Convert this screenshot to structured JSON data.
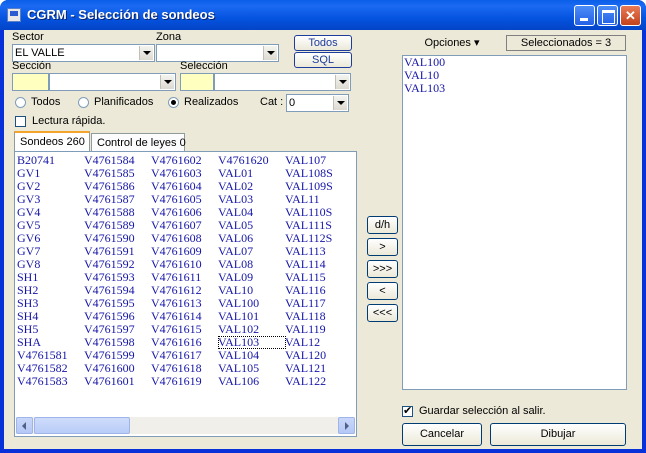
{
  "window": {
    "title": "CGRM - Selección de sondeos"
  },
  "filters": {
    "sector_label": "Sector",
    "sector_value": "EL VALLE",
    "zona_label": "Zona",
    "zona_value": "",
    "seccion_label": "Sección",
    "seccion_value": "",
    "seleccion_label": "Selección",
    "seleccion_value": "",
    "todos_button": "Todos",
    "sql_button": "SQL"
  },
  "radios": [
    {
      "label": "Todos",
      "checked": false
    },
    {
      "label": "Planificados",
      "checked": false
    },
    {
      "label": "Realizados",
      "checked": true
    }
  ],
  "cat": {
    "label": "Cat :",
    "value": "0"
  },
  "lectura_rapida": {
    "label": "Lectura rápida.",
    "checked": false
  },
  "tabs": [
    {
      "label": "Sondeos",
      "count": "260"
    },
    {
      "label": "Control de leyes",
      "count": "0"
    }
  ],
  "grid": {
    "selected": "VAL103",
    "columns": [
      [
        "B20741",
        "GV1",
        "GV2",
        "GV3",
        "GV4",
        "GV5",
        "GV6",
        "GV7",
        "GV8",
        "SH1",
        "SH2",
        "SH3",
        "SH4",
        "SH5",
        "SHA",
        "V4761581",
        "V4761582",
        "V4761583"
      ],
      [
        "V4761584",
        "V4761585",
        "V4761586",
        "V4761587",
        "V4761588",
        "V4761589",
        "V4761590",
        "V4761591",
        "V4761592",
        "V4761593",
        "V4761594",
        "V4761595",
        "V4761596",
        "V4761597",
        "V4761598",
        "V4761599",
        "V4761600",
        "V4761601"
      ],
      [
        "V4761602",
        "V4761603",
        "V4761604",
        "V4761605",
        "V4761606",
        "V4761607",
        "V4761608",
        "V4761609",
        "V4761610",
        "V4761611",
        "V4761612",
        "V4761613",
        "V4761614",
        "V4761615",
        "V4761616",
        "V4761617",
        "V4761618",
        "V4761619"
      ],
      [
        "V4761620",
        "VAL01",
        "VAL02",
        "VAL03",
        "VAL04",
        "VAL05",
        "VAL06",
        "VAL07",
        "VAL08",
        "VAL09",
        "VAL10",
        "VAL100",
        "VAL101",
        "VAL102",
        "VAL103",
        "VAL104",
        "VAL105",
        "VAL106"
      ],
      [
        "VAL107",
        "VAL108S",
        "VAL109S",
        "VAL11",
        "VAL110S",
        "VAL111S",
        "VAL112S",
        "VAL113",
        "VAL114",
        "VAL115",
        "VAL116",
        "VAL117",
        "VAL118",
        "VAL119",
        "VAL12",
        "VAL120",
        "VAL121",
        "VAL122"
      ]
    ]
  },
  "transfer_buttons": [
    "d/h",
    ">",
    ">>>",
    "<",
    "<<<"
  ],
  "right_panel": {
    "options_label": "Opciones",
    "selected_count_label": "Seleccionados = 3",
    "items": [
      "VAL100",
      "VAL10",
      "VAL103"
    ]
  },
  "footer": {
    "guardar_label": "Guardar selección al salir.",
    "guardar_checked": true,
    "cancel_button": "Cancelar",
    "draw_button": "Dibujar"
  },
  "colors": {
    "titlebar": "#0a5ee8",
    "item_text": "#1515a8",
    "input_yellow": "#ffffc0"
  },
  "icons": [
    "app-icon",
    "minimize-icon",
    "maximize-icon",
    "close-icon",
    "chevron-down-icon",
    "scroll-left-icon",
    "scroll-right-icon"
  ]
}
